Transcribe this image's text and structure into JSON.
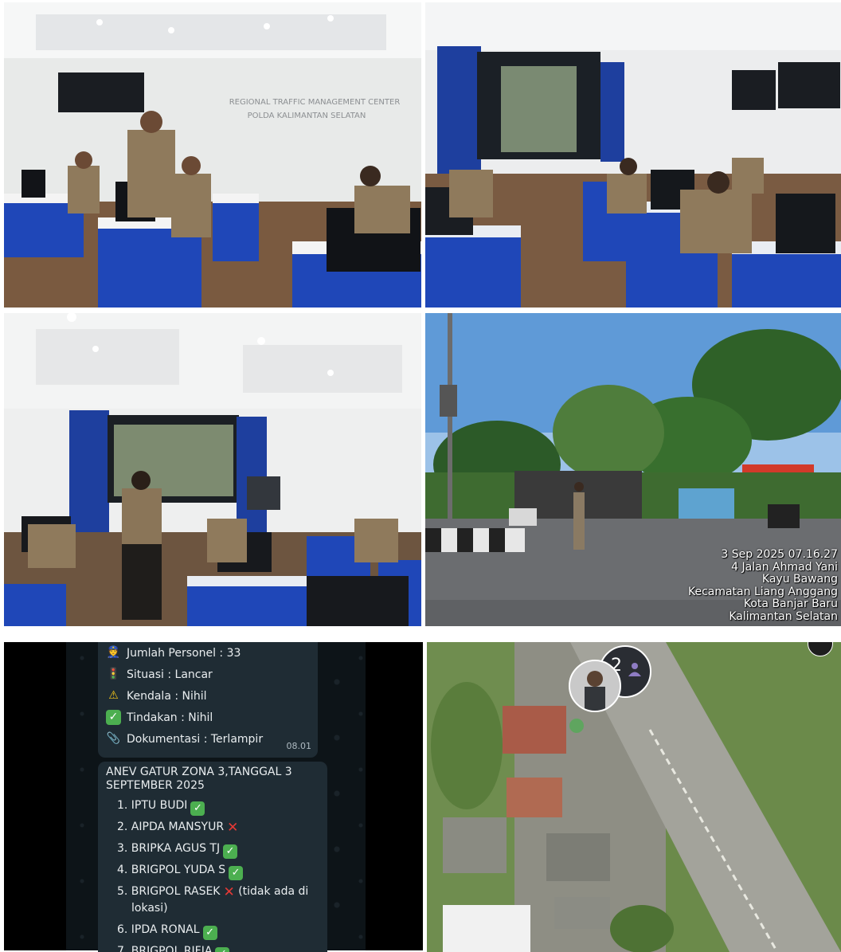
{
  "tiles": {
    "control_room_1": {
      "sign_line1": "REGIONAL TRAFFIC MANAGEMENT CENTER",
      "sign_line2": "POLDA KALIMANTAN SELATAN"
    },
    "street": {
      "stamp_lines": [
        "3 Sep 2025 07.16.27",
        "4 Jalan Ahmad Yani",
        "Kayu Bawang",
        "Kecamatan Liang Anggang",
        "Kota Banjar Baru",
        "Kalimantan Selatan"
      ]
    },
    "chat": {
      "bubble1": {
        "rows": [
          {
            "icon": "police-officer-icon",
            "glyph": "👮",
            "text": "Jumlah Personel : 33"
          },
          {
            "icon": "traffic-light-icon",
            "glyph": "🚦",
            "text": "Situasi : Lancar"
          },
          {
            "icon": "warning-icon",
            "glyph": "⚠",
            "text": "Kendala : Nihil"
          },
          {
            "icon": "check-mark-icon",
            "glyph": "✓",
            "text": "Tindakan : Nihil"
          },
          {
            "icon": "paperclip-icon",
            "glyph": "📎",
            "text": "Dokumentasi : Terlampir"
          }
        ],
        "time": "08.01"
      },
      "bubble2": {
        "header": "ANEV GATUR ZONA 3,TANGGAL 3 SEPTEMBER 2025",
        "items": [
          {
            "text": "1. IPTU BUDI",
            "status": "present"
          },
          {
            "text": "2. AIPDA MANSYUR",
            "status": "absent"
          },
          {
            "text": "3. BRIPKA AGUS TJ",
            "status": "present"
          },
          {
            "text": "4. BRIGPOL YUDA S",
            "status": "present"
          },
          {
            "text": "5. BRIGPOL RASEK",
            "status": "absent",
            "note": "(tidak ada di",
            "note2": "lokasi)"
          },
          {
            "text": "6. IPDA RONAL",
            "status": "present"
          },
          {
            "text": "7. BRIGPOL RIFIA",
            "status": "present"
          }
        ]
      }
    },
    "map": {
      "cluster_count": "2"
    }
  },
  "colors": {
    "desk_blue": "#1f47b8",
    "chat_bubble": "#1f2c34",
    "check_green": "#4caf50",
    "cross_red": "#e53935"
  }
}
